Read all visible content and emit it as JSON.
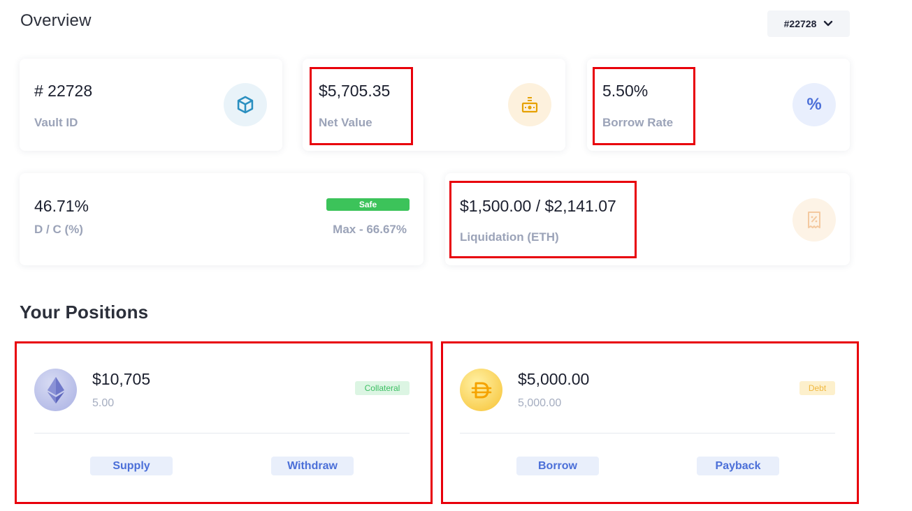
{
  "overview": {
    "title": "Overview",
    "vault_selector": {
      "value": "#22728",
      "icon": "chevron-down-icon"
    }
  },
  "stats": {
    "vault_id": {
      "value": "# 22728",
      "label": "Vault ID",
      "icon": "cube-icon"
    },
    "net_value": {
      "value": "$5,705.35",
      "label": "Net Value",
      "icon": "cash-register-icon"
    },
    "borrow_rate": {
      "value": "5.50%",
      "label": "Borrow Rate",
      "icon": "percent-icon"
    },
    "dc_ratio": {
      "value": "46.71%",
      "label": "D / C (%)",
      "status": "Safe",
      "max": "Max - 66.67%"
    },
    "liquidation": {
      "value": "$1,500.00 / $2,141.07",
      "label": "Liquidation (ETH)",
      "icon": "receipt-percent-icon"
    }
  },
  "positions": {
    "title": "Your Positions",
    "collateral": {
      "icon": "ethereum-icon",
      "value": "$10,705",
      "amount": "5.00",
      "badge": "Collateral",
      "actions": [
        "Supply",
        "Withdraw"
      ]
    },
    "debt": {
      "icon": "dai-icon",
      "value": "$5,000.00",
      "amount": "5,000.00",
      "badge": "Debt",
      "actions": [
        "Borrow",
        "Payback"
      ]
    }
  },
  "colors": {
    "highlight": "#e8000b",
    "safe_green": "#3cc35a",
    "accent_blue": "#4b6fd8",
    "label_gray": "#9ba3b8"
  }
}
